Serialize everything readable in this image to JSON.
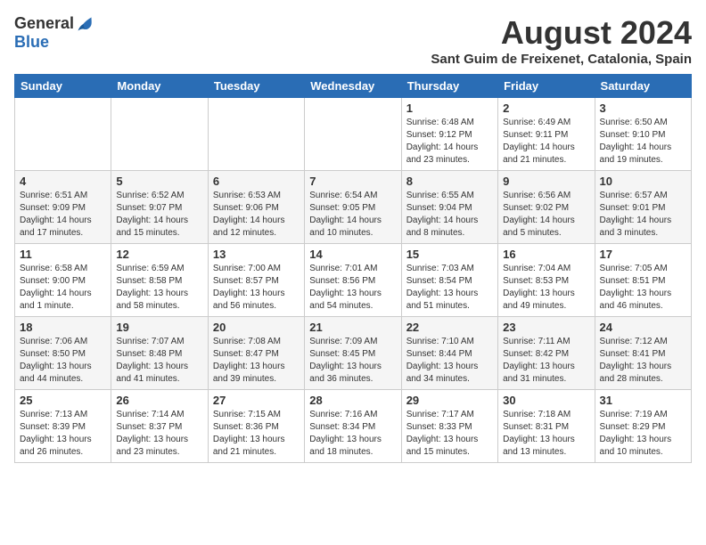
{
  "logo": {
    "general": "General",
    "blue": "Blue"
  },
  "title": "August 2024",
  "subtitle": "Sant Guim de Freixenet, Catalonia, Spain",
  "weekdays": [
    "Sunday",
    "Monday",
    "Tuesday",
    "Wednesday",
    "Thursday",
    "Friday",
    "Saturday"
  ],
  "weeks": [
    [
      {
        "day": "",
        "sunrise": "",
        "sunset": "",
        "daylight": ""
      },
      {
        "day": "",
        "sunrise": "",
        "sunset": "",
        "daylight": ""
      },
      {
        "day": "",
        "sunrise": "",
        "sunset": "",
        "daylight": ""
      },
      {
        "day": "",
        "sunrise": "",
        "sunset": "",
        "daylight": ""
      },
      {
        "day": "1",
        "sunrise": "Sunrise: 6:48 AM",
        "sunset": "Sunset: 9:12 PM",
        "daylight": "Daylight: 14 hours and 23 minutes."
      },
      {
        "day": "2",
        "sunrise": "Sunrise: 6:49 AM",
        "sunset": "Sunset: 9:11 PM",
        "daylight": "Daylight: 14 hours and 21 minutes."
      },
      {
        "day": "3",
        "sunrise": "Sunrise: 6:50 AM",
        "sunset": "Sunset: 9:10 PM",
        "daylight": "Daylight: 14 hours and 19 minutes."
      }
    ],
    [
      {
        "day": "4",
        "sunrise": "Sunrise: 6:51 AM",
        "sunset": "Sunset: 9:09 PM",
        "daylight": "Daylight: 14 hours and 17 minutes."
      },
      {
        "day": "5",
        "sunrise": "Sunrise: 6:52 AM",
        "sunset": "Sunset: 9:07 PM",
        "daylight": "Daylight: 14 hours and 15 minutes."
      },
      {
        "day": "6",
        "sunrise": "Sunrise: 6:53 AM",
        "sunset": "Sunset: 9:06 PM",
        "daylight": "Daylight: 14 hours and 12 minutes."
      },
      {
        "day": "7",
        "sunrise": "Sunrise: 6:54 AM",
        "sunset": "Sunset: 9:05 PM",
        "daylight": "Daylight: 14 hours and 10 minutes."
      },
      {
        "day": "8",
        "sunrise": "Sunrise: 6:55 AM",
        "sunset": "Sunset: 9:04 PM",
        "daylight": "Daylight: 14 hours and 8 minutes."
      },
      {
        "day": "9",
        "sunrise": "Sunrise: 6:56 AM",
        "sunset": "Sunset: 9:02 PM",
        "daylight": "Daylight: 14 hours and 5 minutes."
      },
      {
        "day": "10",
        "sunrise": "Sunrise: 6:57 AM",
        "sunset": "Sunset: 9:01 PM",
        "daylight": "Daylight: 14 hours and 3 minutes."
      }
    ],
    [
      {
        "day": "11",
        "sunrise": "Sunrise: 6:58 AM",
        "sunset": "Sunset: 9:00 PM",
        "daylight": "Daylight: 14 hours and 1 minute."
      },
      {
        "day": "12",
        "sunrise": "Sunrise: 6:59 AM",
        "sunset": "Sunset: 8:58 PM",
        "daylight": "Daylight: 13 hours and 58 minutes."
      },
      {
        "day": "13",
        "sunrise": "Sunrise: 7:00 AM",
        "sunset": "Sunset: 8:57 PM",
        "daylight": "Daylight: 13 hours and 56 minutes."
      },
      {
        "day": "14",
        "sunrise": "Sunrise: 7:01 AM",
        "sunset": "Sunset: 8:56 PM",
        "daylight": "Daylight: 13 hours and 54 minutes."
      },
      {
        "day": "15",
        "sunrise": "Sunrise: 7:03 AM",
        "sunset": "Sunset: 8:54 PM",
        "daylight": "Daylight: 13 hours and 51 minutes."
      },
      {
        "day": "16",
        "sunrise": "Sunrise: 7:04 AM",
        "sunset": "Sunset: 8:53 PM",
        "daylight": "Daylight: 13 hours and 49 minutes."
      },
      {
        "day": "17",
        "sunrise": "Sunrise: 7:05 AM",
        "sunset": "Sunset: 8:51 PM",
        "daylight": "Daylight: 13 hours and 46 minutes."
      }
    ],
    [
      {
        "day": "18",
        "sunrise": "Sunrise: 7:06 AM",
        "sunset": "Sunset: 8:50 PM",
        "daylight": "Daylight: 13 hours and 44 minutes."
      },
      {
        "day": "19",
        "sunrise": "Sunrise: 7:07 AM",
        "sunset": "Sunset: 8:48 PM",
        "daylight": "Daylight: 13 hours and 41 minutes."
      },
      {
        "day": "20",
        "sunrise": "Sunrise: 7:08 AM",
        "sunset": "Sunset: 8:47 PM",
        "daylight": "Daylight: 13 hours and 39 minutes."
      },
      {
        "day": "21",
        "sunrise": "Sunrise: 7:09 AM",
        "sunset": "Sunset: 8:45 PM",
        "daylight": "Daylight: 13 hours and 36 minutes."
      },
      {
        "day": "22",
        "sunrise": "Sunrise: 7:10 AM",
        "sunset": "Sunset: 8:44 PM",
        "daylight": "Daylight: 13 hours and 34 minutes."
      },
      {
        "day": "23",
        "sunrise": "Sunrise: 7:11 AM",
        "sunset": "Sunset: 8:42 PM",
        "daylight": "Daylight: 13 hours and 31 minutes."
      },
      {
        "day": "24",
        "sunrise": "Sunrise: 7:12 AM",
        "sunset": "Sunset: 8:41 PM",
        "daylight": "Daylight: 13 hours and 28 minutes."
      }
    ],
    [
      {
        "day": "25",
        "sunrise": "Sunrise: 7:13 AM",
        "sunset": "Sunset: 8:39 PM",
        "daylight": "Daylight: 13 hours and 26 minutes."
      },
      {
        "day": "26",
        "sunrise": "Sunrise: 7:14 AM",
        "sunset": "Sunset: 8:37 PM",
        "daylight": "Daylight: 13 hours and 23 minutes."
      },
      {
        "day": "27",
        "sunrise": "Sunrise: 7:15 AM",
        "sunset": "Sunset: 8:36 PM",
        "daylight": "Daylight: 13 hours and 21 minutes."
      },
      {
        "day": "28",
        "sunrise": "Sunrise: 7:16 AM",
        "sunset": "Sunset: 8:34 PM",
        "daylight": "Daylight: 13 hours and 18 minutes."
      },
      {
        "day": "29",
        "sunrise": "Sunrise: 7:17 AM",
        "sunset": "Sunset: 8:33 PM",
        "daylight": "Daylight: 13 hours and 15 minutes."
      },
      {
        "day": "30",
        "sunrise": "Sunrise: 7:18 AM",
        "sunset": "Sunset: 8:31 PM",
        "daylight": "Daylight: 13 hours and 13 minutes."
      },
      {
        "day": "31",
        "sunrise": "Sunrise: 7:19 AM",
        "sunset": "Sunset: 8:29 PM",
        "daylight": "Daylight: 13 hours and 10 minutes."
      }
    ]
  ]
}
